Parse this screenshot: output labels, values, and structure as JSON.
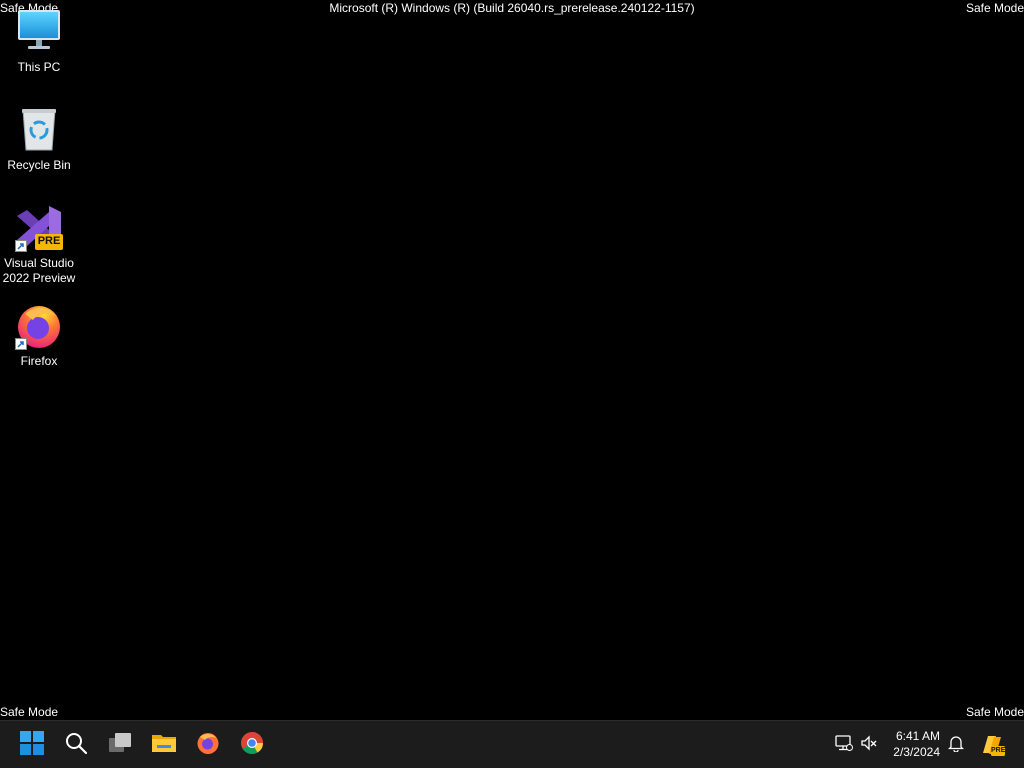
{
  "watermarks": {
    "top_left": "Safe Mode",
    "top_right": "Safe Mode",
    "bottom_left": "Safe Mode",
    "bottom_right": "Safe Mode",
    "build_title": "Microsoft (R) Windows (R) (Build 26040.rs_prerelease.240122-1157)"
  },
  "desktop_icons": [
    {
      "label": "This PC",
      "icon": "monitor-icon"
    },
    {
      "label": "Recycle Bin",
      "icon": "recycle-bin-icon"
    },
    {
      "label": "Visual Studio 2022 Preview",
      "icon": "visual-studio-preview-icon",
      "badge": "PRE"
    },
    {
      "label": "Firefox",
      "icon": "firefox-icon"
    }
  ],
  "taskbar": {
    "pinned": [
      {
        "name": "start",
        "icon": "windows-logo-icon"
      },
      {
        "name": "search",
        "icon": "search-icon"
      },
      {
        "name": "task-view",
        "icon": "task-view-icon"
      },
      {
        "name": "file-explorer",
        "icon": "folder-icon"
      },
      {
        "name": "firefox",
        "icon": "firefox-icon"
      },
      {
        "name": "chrome",
        "icon": "chrome-icon"
      }
    ],
    "tray": {
      "network_icon": "network-disconnected-icon",
      "volume_icon": "volume-muted-icon",
      "time": "6:41 AM",
      "date": "2/3/2024",
      "notification_icon": "bell-icon",
      "copilot_badge": "PRE"
    }
  },
  "colors": {
    "desktop_background": "#000000",
    "taskbar_background": "#1c1c1c",
    "windows_blue": "#1e90ff",
    "vs_purple": "#7b4fc9",
    "pre_badge": "#f5b800"
  }
}
